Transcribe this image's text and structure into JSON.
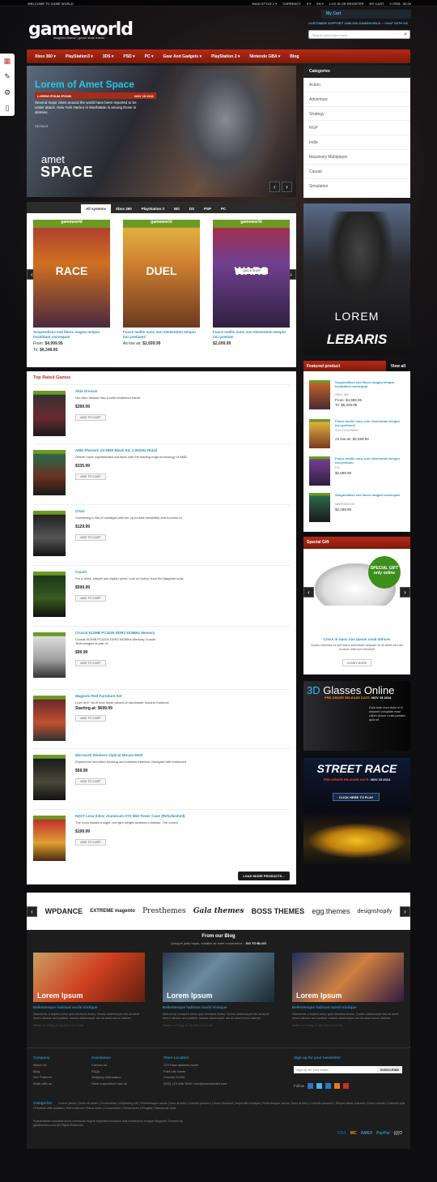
{
  "topbar": {
    "welcome": "WELCOME TO GAME WORLD",
    "links": [
      "MAIN STYLE 2 ▾",
      "CURRENCY",
      "$ ▾",
      "EN ▾",
      "LOG IN OR REGISTER",
      "MY CART",
      "0 ITEM - $0.00"
    ]
  },
  "header": {
    "logo": "gameworld",
    "tagline": "magento theme / game store theme",
    "my_cart": "My Cart",
    "support": "CUSTOMER SUPPORT 1800.000.GAMEWORLD :: CHAT WITH US",
    "search_placeholder": "Search entire store here"
  },
  "nav": [
    "Xbox 360 ▾",
    "PlayStation3 ▾",
    "3DS ▾",
    "PSD ▾",
    "PC ▾",
    "Gear And Gadgets ▾",
    "PlayStation 2 ▾",
    "Nintendo GBA ▾",
    "Blog"
  ],
  "slider": {
    "title": "Lorem of Amet Space",
    "subtitle": "LOREM IPSUM IPSUM",
    "date": "NOV 15 2011",
    "description": "Several major cities around the world have been reported to be under attack. New York Harbor in Manhattan is among those in distress.",
    "detail": "DETAILS",
    "big1": "amet",
    "big2": "SPACE"
  },
  "tabs": {
    "items": [
      "All systems",
      "Xbox 360",
      "PlayStation 3",
      "Wii",
      "DS",
      "PSP",
      "PC"
    ],
    "products": [
      {
        "game": "RACE",
        "name": "Suspendisse sed libero magna tempor incididunt consequat",
        "from_label": "From:",
        "from": "$4,999.95",
        "to_label": "To:",
        "to": "$6,348.95"
      },
      {
        "game": "DUEL",
        "name": "Fusce mollis nunc non elementum tempor inci pretiumC",
        "from_label": "As low as:",
        "from": "$2,699.99",
        "to_label": "",
        "to": ""
      },
      {
        "game": "WARS",
        "name": "Fusce mollis nunc non elementum tempor inci pretium",
        "from_label": "",
        "from": "$2,699.99",
        "to_label": "",
        "to": ""
      }
    ],
    "gw_label": "gameworld",
    "quick_shop": "QUICK SHOP"
  },
  "top_rated": {
    "title": "Top Rated Games",
    "add_to_cart": "ADD TO CART",
    "load_more": "LOAD MORE PRODUCTS...",
    "items": [
      {
        "name": "Akio Dresser",
        "desc": "Our Akio dresser has a solid hardwood frame.",
        "price": "$399.99"
      },
      {
        "name": "AMD Phenom X4 9850 Black Ed. 2.50GHz Retail",
        "desc": "Deliver more sophisticated solutions with the leading-edge technology of AMD",
        "price": "$335.99"
      },
      {
        "name": "Chair",
        "desc": "Combining a hint of nostalgia with the up-to-date sensibility and function of",
        "price": "$129.99"
      },
      {
        "name": "Couch",
        "desc": "For a sleek, simple and stylish piece, look no further than the Magento sofa-",
        "price": "$599.99"
      },
      {
        "name": "Crucial 512MB PC4200 DDR2 533MHz Memory",
        "desc": "Crucial 512MB PC4200 DDR2 533MHz Memory Crucial Technologies is part of",
        "price": "$99.99"
      },
      {
        "name": "Magento Red Furniture Set",
        "desc": "Love red? You'll love these pieces of handmade modern furniture!",
        "price": "Starting at: $699.99"
      },
      {
        "name": "Microsoft Wireless Optical Mouse 5000",
        "desc": "Experience smoother tracking and wireless freedom. Navigate with enhanced",
        "price": "$59.99"
      },
      {
        "name": "NZXT Lexa Silver Aluminum ATX Mid-Tower Case (Refurbished)",
        "desc": "The Lexa boasts a slight, but light weight aluminum chassis. The Lexa's",
        "price": "$199.99"
      }
    ]
  },
  "categories": {
    "title": "Categories",
    "items": [
      "Action",
      "Adventure",
      "Strategy",
      "RGP",
      "Indie",
      "Massively Multiplayer",
      "Casual",
      "Simulation"
    ]
  },
  "lebaris": {
    "line1": "LOREM",
    "line2": "LEBARIS"
  },
  "featured": {
    "title": "Featured product",
    "view_all": "View all",
    "items": [
      {
        "name": "Suspendisse sed libero magna tempor incididunt consequat",
        "sku": "XBOX 360",
        "p1": "From: $4,999.95",
        "p2": "To: $6,348.95"
      },
      {
        "name": "Fusce mollis nunc non elementum tempor inci pretiumC",
        "sku": "VGN-TXN27N/BW",
        "p1": "As low as: $2,699.99",
        "p2": ""
      },
      {
        "name": "Fusce mollis nunc non elementum tempor inci pretium",
        "sku": "P32",
        "p1": "$2,699.99",
        "p2": ""
      },
      {
        "name": "Suspendisse sed libero magna consequat",
        "sku": "NINTENDO DS",
        "p1": "$2,299.99",
        "p2": ""
      }
    ]
  },
  "gift": {
    "title": "Special Gift",
    "badge": "SPECIAL GIFT only online",
    "name": "Cross in nunc non ipsum couk ultrices",
    "desc": "Donec vehicula mi sed tellus sollicitudin aliquam sit sit amet sed dui ut lacus interdum tincidunt",
    "learn_more": "LEARN MORE"
  },
  "ad3d": {
    "title_a": "3D",
    "title_b": "Glasses Online",
    "release": "PRE-ORDER RELEASE DATE:",
    "date": "NOV 15 2014",
    "text": "Duis aute irure dolor in in dolorem voluptate esse cillum dolore mulla pariatur quia sit"
  },
  "street": {
    "title": "STREET RACE",
    "release": "PRE-ORDER RELEASE DATE:",
    "date": "NOV 15 2014",
    "cta": "CLICK HERE TO PLAY"
  },
  "brands": [
    "WPDANCE",
    "EXTREME magento",
    "Presthemes",
    "Gala themes",
    "BOSS THEMES",
    "egg.themes",
    "designshopify"
  ],
  "blog": {
    "title": "From our Blog",
    "subtitle": "Quisque justo turpis, sodales sit amet consectetur",
    "go": "GO TO BLOG",
    "posts": [
      {
        "label": "Lorem Ipsum",
        "title": "Bellentesque habitant morbi tristique",
        "desc": "Maecenas a sapien tortor quis tincidunt lectus. Donec ullamcorper dui sit amet lorem ultrices sed porttitor massa ullamcorper dui sit amet lorem ultrices",
        "written": "Written on Friday, 8 July 2011 07:10 AM"
      },
      {
        "label": "Lorem Ipsum",
        "title": "Bellentesque habitant morbi tristique",
        "desc": "Maecenas a sapien tortor quis tincidunt lectus. Donec ullamcorper dui sit amet lorem ultrices sed porttitor massa ullamcorper dui sit amet lorem ultrices",
        "written": "Written on Friday, 8 July 2011 07:10 AM"
      },
      {
        "label": "Lorem Ipsum",
        "title": "Bellentesque habitant morbi tristique",
        "desc": "Maecenas a sapien tortor quis tincidunt lectus. Donec ullamcorper dui sit amet lorem ultrices sed porttitor massa ullamcorper dui sit amet lorem ultrices",
        "written": "Written on Friday, 8 July 2011 07:10 AM"
      }
    ]
  },
  "footer": {
    "company": {
      "title": "Company",
      "links": [
        "About Us",
        "Blog",
        "Our Partners",
        "Work with us"
      ]
    },
    "assistance": {
      "title": "Assistance",
      "links": [
        "Contact us",
        "FAQs",
        "Shipping Information",
        "Have a question? ask us"
      ]
    },
    "store": {
      "title": "Store Location",
      "lines": [
        "123 Fake address name",
        "Fake city name",
        "Country 01234",
        "(000) 123 456 7890 / info@yourdomain.com"
      ]
    },
    "newsletter": {
      "title": "Sign up for your newsletter",
      "placeholder": "Sign up for your email...",
      "button": "SUBSCRIBE"
    },
    "follow": "Follow",
    "categories_label": "Categories",
    "categories": "Lorem ipsum | Dolor sit amet | Consectetur | Adipiscing elit | Pellentesque varius | Arcu at felis | Lobortis posuere | Nunc tincidunt | Imperdiet volutpat | Pellentesque varius | Arcu at felis | Lobortis posuere | Suspendisse posuere | Dolor mauris | Lobortis quis | Facilisis velit sodales | Sed euismod | Risus dolor | Consectetur | Elementum | Fringilla | Maecenas Quis",
    "copyright": "Suspendisse convallis lacus commodo augue imperdiet tincidunt duis fermentum congue Magento Themes by galathemes.com All Rights Reserved",
    "payments": [
      "VISA",
      "MC",
      "AMEX",
      "PayPal",
      "((((O"
    ]
  }
}
